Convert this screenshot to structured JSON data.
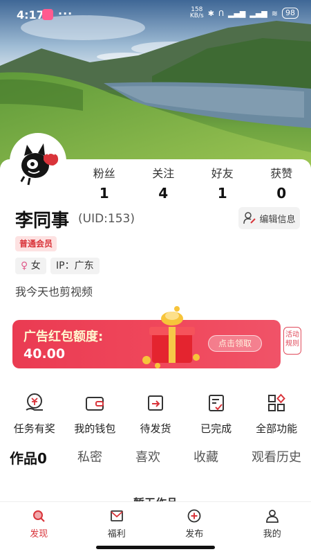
{
  "status_bar": {
    "time": "4:17",
    "more": "···",
    "net_speed": "158",
    "net_unit": "KB/s",
    "battery": "98"
  },
  "profile": {
    "stats": [
      {
        "label": "粉丝",
        "value": "1"
      },
      {
        "label": "关注",
        "value": "4"
      },
      {
        "label": "好友",
        "value": "1"
      },
      {
        "label": "获赞",
        "value": "0"
      }
    ],
    "name": "李同事",
    "uid": "(UID:153)",
    "edit_label": "编辑信息",
    "member_badge": "普通会员",
    "gender": "女",
    "ip": "IP：广东",
    "bio": "我今天也剪视频"
  },
  "ad": {
    "title": "广告红包额度:",
    "amount": "40.00",
    "claim": "点击领取",
    "rules_line1": "活动",
    "rules_line2": "规则"
  },
  "functions": [
    {
      "label": "任务有奖",
      "icon": "task-reward-icon"
    },
    {
      "label": "我的钱包",
      "icon": "wallet-icon"
    },
    {
      "label": "待发货",
      "icon": "pending-shipment-icon"
    },
    {
      "label": "已完成",
      "icon": "completed-icon"
    },
    {
      "label": "全部功能",
      "icon": "all-functions-icon"
    }
  ],
  "tabs": [
    "作品0",
    "私密",
    "喜欢",
    "收藏",
    "观看历史"
  ],
  "peek_text": "暂无作品",
  "bottom_nav": [
    {
      "label": "发现",
      "icon": "search-icon",
      "active": true
    },
    {
      "label": "福利",
      "icon": "mail-icon",
      "active": false
    },
    {
      "label": "发布",
      "icon": "plus-circle-icon",
      "active": false
    },
    {
      "label": "我的",
      "icon": "person-icon",
      "active": false
    }
  ],
  "colors": {
    "accent": "#d9343a",
    "ad_bg": "#ea3b52"
  }
}
